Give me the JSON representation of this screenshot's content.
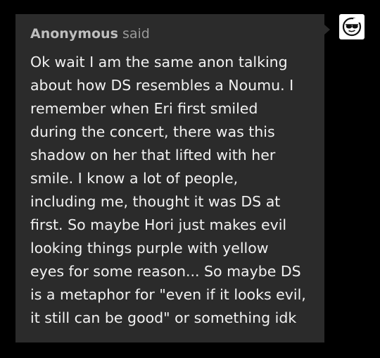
{
  "ask": {
    "asker": "Anonymous",
    "said": "said",
    "lines": [
      "Ok wait I am the same anon talking",
      "about how DS resembles a Noumu. I",
      "remember when Eri first smiled",
      "during the concert, there was this",
      "shadow on her that lifted with her",
      "smile. I know a lot of people,",
      "including me, thought it was DS at",
      "first. So maybe Hori just makes evil",
      "looking things purple with yellow",
      "eyes for some reason... So maybe DS",
      "is a metaphor for \"even if it looks evil,",
      "it still can be good\" or something idk"
    ]
  },
  "avatar": {
    "icon": "anonymous-sunglasses-avatar-icon"
  },
  "colors": {
    "background": "#000000",
    "box": "#2b2b2b",
    "text": "#f2f2f2",
    "header": "#9e9e9e"
  }
}
